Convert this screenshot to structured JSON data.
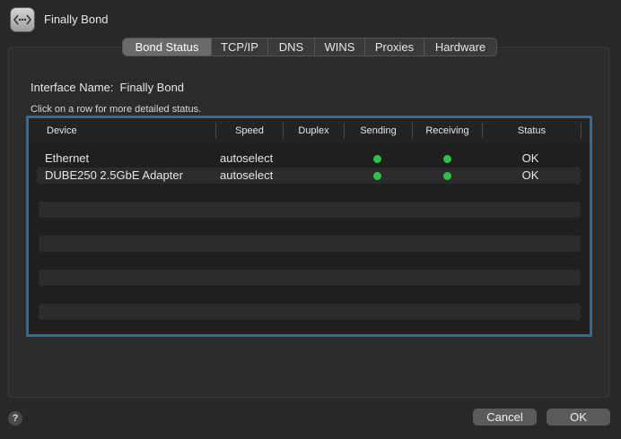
{
  "window": {
    "title": "Finally Bond",
    "icon": "network-bond-icon"
  },
  "tabs": [
    {
      "label": "Bond Status",
      "active": true
    },
    {
      "label": "TCP/IP"
    },
    {
      "label": "DNS"
    },
    {
      "label": "WINS"
    },
    {
      "label": "Proxies"
    },
    {
      "label": "Hardware"
    }
  ],
  "interface": {
    "label": "Interface Name:",
    "value": "Finally Bond"
  },
  "hint": "Click on a row for more detailed status.",
  "table": {
    "columns": [
      "Device",
      "Speed",
      "Duplex",
      "Sending",
      "Receiving",
      "Status"
    ],
    "rows": [
      {
        "device": "Ethernet",
        "speed": "autoselect",
        "duplex": "",
        "sending": "green",
        "receiving": "green",
        "status": "OK"
      },
      {
        "device": "DUBE250 2.5GbE Adapter",
        "speed": "autoselect",
        "duplex": "",
        "sending": "green",
        "receiving": "green",
        "status": "OK"
      }
    ]
  },
  "colors": {
    "selection_border": "#2d6ba7",
    "status_dot": "#2fc24a"
  },
  "buttons": {
    "help": "?",
    "cancel": "Cancel",
    "ok": "OK"
  }
}
